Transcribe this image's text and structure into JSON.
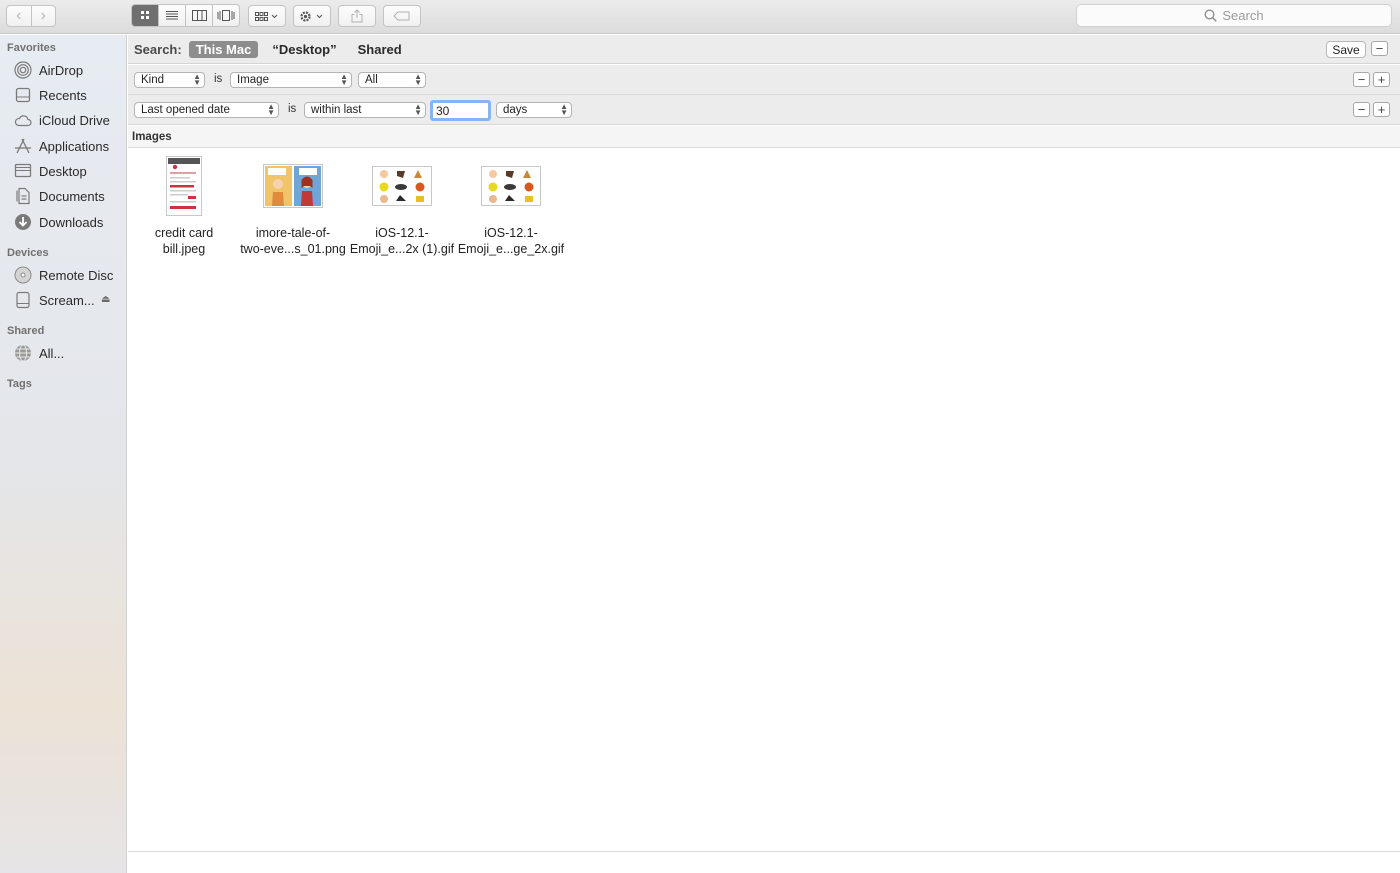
{
  "toolbar": {
    "search_placeholder": "Search"
  },
  "sidebar": {
    "favorites_header": "Favorites",
    "favorites": [
      {
        "label": "AirDrop",
        "icon": "airdrop-icon"
      },
      {
        "label": "Recents",
        "icon": "recents-icon"
      },
      {
        "label": "iCloud Drive",
        "icon": "cloud-icon"
      },
      {
        "label": "Applications",
        "icon": "applications-icon"
      },
      {
        "label": "Desktop",
        "icon": "desktop-icon"
      },
      {
        "label": "Documents",
        "icon": "documents-icon"
      },
      {
        "label": "Downloads",
        "icon": "downloads-icon"
      }
    ],
    "devices_header": "Devices",
    "devices": [
      {
        "label": "Remote Disc",
        "icon": "disc-icon"
      },
      {
        "label": "Scream...",
        "icon": "drive-icon"
      }
    ],
    "shared_header": "Shared",
    "shared": [
      {
        "label": "All...",
        "icon": "network-icon"
      }
    ],
    "tags_header": "Tags"
  },
  "search_bar": {
    "label": "Search:",
    "scopes": [
      "This Mac",
      "“Desktop”",
      "Shared"
    ],
    "active_scope": "This Mac",
    "save_label": "Save"
  },
  "rules": [
    {
      "attribute": "Kind",
      "operator": "is",
      "value": "Image",
      "extra": "All"
    },
    {
      "attribute": "Last opened date",
      "operator": "is",
      "value": "within last",
      "number": "30",
      "unit": "days"
    }
  ],
  "results": {
    "section_title": "Images",
    "files": [
      {
        "line1": "credit card",
        "line2": "bill.jpeg"
      },
      {
        "line1": "imore-tale-of-",
        "line2": "two-eve...s_01.png"
      },
      {
        "line1": "iOS-12.1-",
        "line2": "Emoji_e...2x (1).gif"
      },
      {
        "line1": "iOS-12.1-",
        "line2": "Emoji_e...ge_2x.gif"
      }
    ]
  },
  "colors": {
    "active_scope_bg": "#8d8d8d",
    "focus_ring": "#86b5ef",
    "sidebar_top": "#e7ecf2",
    "sidebar_bottom": "#ece2d6"
  }
}
